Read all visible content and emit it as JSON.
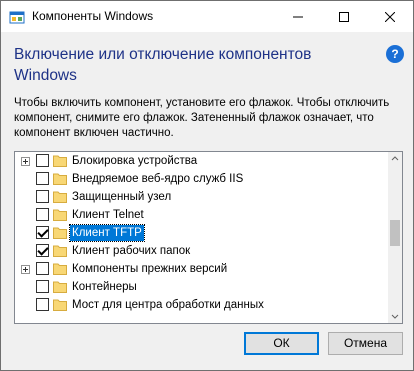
{
  "window": {
    "title": "Компоненты Windows",
    "icon": "windows-features-icon"
  },
  "titlebar": {
    "minimize_icon": "minimize-icon",
    "maximize_icon": "maximize-icon",
    "close_icon": "close-icon"
  },
  "header": {
    "heading": "Включение или отключение компонентов Windows",
    "help_label": "?"
  },
  "description": "Чтобы включить компонент, установите его флажок. Чтобы отключить компонент, снимите его флажок. Затененный флажок означает, что компонент включен частично.",
  "features": [
    {
      "label": "Блокировка устройства",
      "expandable": true,
      "checked": false,
      "selected": false
    },
    {
      "label": "Внедряемое веб-ядро служб IIS",
      "expandable": false,
      "checked": false,
      "selected": false
    },
    {
      "label": "Защищенный узел",
      "expandable": false,
      "checked": false,
      "selected": false
    },
    {
      "label": "Клиент Telnet",
      "expandable": false,
      "checked": false,
      "selected": false
    },
    {
      "label": "Клиент TFTP",
      "expandable": false,
      "checked": true,
      "selected": true
    },
    {
      "label": "Клиент рабочих папок",
      "expandable": false,
      "checked": true,
      "selected": false
    },
    {
      "label": "Компоненты прежних версий",
      "expandable": true,
      "checked": false,
      "selected": false
    },
    {
      "label": "Контейнеры",
      "expandable": false,
      "checked": false,
      "selected": false
    },
    {
      "label": "Мост для центра обработки данных",
      "expandable": false,
      "checked": false,
      "selected": false
    }
  ],
  "buttons": {
    "ok": "ОК",
    "cancel": "Отмена"
  },
  "colors": {
    "heading": "#1e3287",
    "selection": "#0078d7",
    "folder": "#f8d775",
    "help": "#1a6fd6"
  }
}
